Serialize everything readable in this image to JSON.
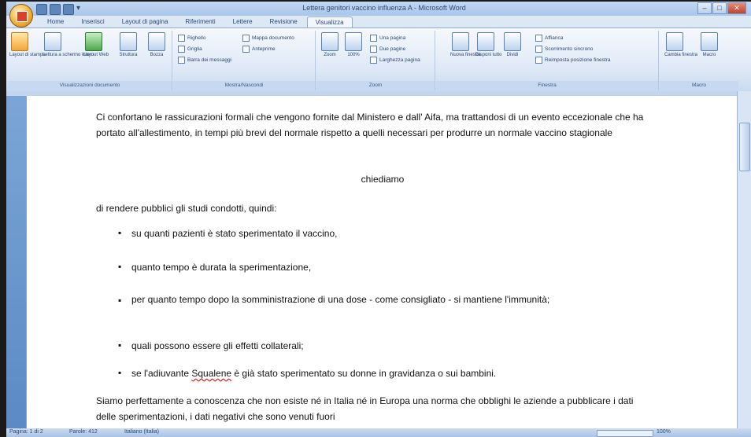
{
  "window": {
    "title": "Lettera genitori vaccino influenza A - Microsoft Word"
  },
  "tabs": [
    "Home",
    "Inserisci",
    "Layout di pagina",
    "Riferimenti",
    "Lettere",
    "Revisione",
    "Visualizza"
  ],
  "active_tab": "Visualizza",
  "ribbon": {
    "groups": [
      {
        "label": "Visualizzazioni documento",
        "buttons": [
          "Layout di stampa",
          "Lettura a schermo intero",
          "Layout Web",
          "Struttura",
          "Bozza"
        ]
      },
      {
        "label": "Mostra/Nascondi",
        "items": [
          "Righello",
          "Griglia",
          "Barra dei messaggi",
          "Mappa documento",
          "Anteprime"
        ]
      },
      {
        "label": "Zoom",
        "items": [
          "Zoom",
          "100%",
          "Una pagina",
          "Due pagine",
          "Larghezza pagina"
        ]
      },
      {
        "label": "Finestra",
        "items": [
          "Nuova finestra",
          "Disponi tutto",
          "Dividi",
          "Affianca",
          "Scorrimento sincrono",
          "Reimposta posizione finestra"
        ]
      },
      {
        "label": "Macro",
        "items": [
          "Cambia finestra",
          "Macro"
        ]
      }
    ]
  },
  "document": {
    "para1": "Ci confortano le rassicurazioni formali che vengono fornite dal Ministero e dall' Aifa, ma trattandosi di un evento eccezionale che ha portato all'allestimento, in tempi più brevi del normale rispetto a quelli necessari per produrre un normale  vaccino stagionale",
    "center": "chiediamo",
    "para2": "di rendere pubblici gli studi condotti, quindi:",
    "bullets": [
      "su quanti pazienti è stato sperimentato  il vaccino,",
      " quanto tempo è durata la sperimentazione,",
      " per quanto tempo dopo la somministrazione di una dose - come consigliato - si mantiene l'immunità;",
      "quali possono essere gli effetti collaterali;",
      "se l'adiuvante  Squalene  è già stato sperimentato su donne in gravidanza o sui bambini."
    ],
    "bullet_squalene_pre": "se l'adiuvante  ",
    "bullet_squalene_word": "Squalene",
    "bullet_squalene_post": "  è già stato sperimentato su donne in gravidanza o sui bambini.",
    "para3": "Siamo perfettamente a conoscenza che non esiste né in Italia né in Europa una norma che obblighi le aziende a pubblicare i dati delle sperimentazioni, i dati negativi che sono venuti fuori"
  },
  "statusbar": {
    "page": "Pagina: 1 di 2",
    "words": "Parole: 412",
    "language": "Italiano (Italia)",
    "zoom": "100%"
  },
  "colors": {
    "ribbon_bg": "#dce7f5",
    "doc_bg": "#6b98cd",
    "text": "#111111"
  }
}
